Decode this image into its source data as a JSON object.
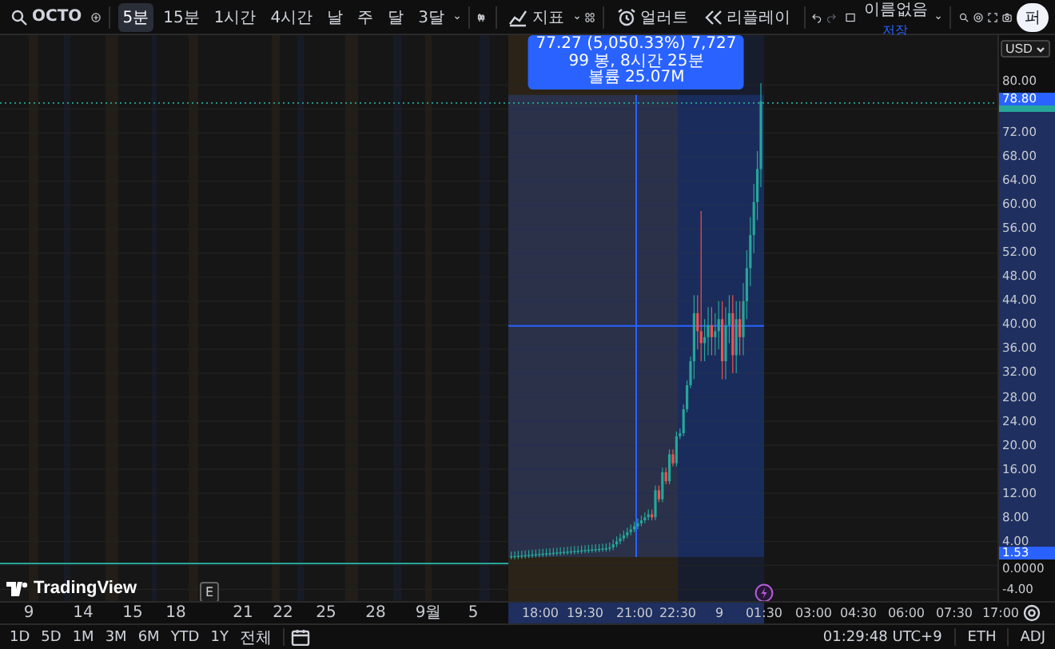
{
  "toolbar": {
    "symbol": "OCTO",
    "intervals": [
      {
        "label": "5분",
        "selected": true
      },
      {
        "label": "15분",
        "selected": false
      },
      {
        "label": "1시간",
        "selected": false
      },
      {
        "label": "4시간",
        "selected": false
      },
      {
        "label": "날",
        "selected": false
      },
      {
        "label": "주",
        "selected": false
      },
      {
        "label": "달",
        "selected": false
      },
      {
        "label": "3달",
        "selected": false
      }
    ],
    "indicators_label": "지표",
    "alert_label": "얼러트",
    "replay_label": "리플레이",
    "layout": {
      "name": "이름없음",
      "status": "저장"
    },
    "profile_button": "퍼"
  },
  "chart": {
    "currency": "USD",
    "price_ticks": [
      "80.00",
      "72.00",
      "68.00",
      "64.00",
      "60.00",
      "56.00",
      "52.00",
      "48.00",
      "44.00",
      "40.00",
      "36.00",
      "32.00",
      "28.00",
      "24.00",
      "20.00",
      "16.00",
      "12.00",
      "8.00",
      "4.00",
      "0.0000",
      "-4.00"
    ],
    "range_high": "78.80",
    "range_low": "1.53",
    "tooltip": [
      "77.27 (5,050.33%) 7,727",
      "99 봉, 8시간 25분",
      "볼륨 25.07M"
    ],
    "event_marker": "E",
    "logo": "TradingView",
    "time_labels": [
      "9",
      "14",
      "15",
      "18",
      "21",
      "22",
      "25",
      "28",
      "9월",
      "5",
      "18:00",
      "19:30",
      "21:00",
      "22:30",
      "9",
      "01:30",
      "03:00",
      "04:30",
      "06:00",
      "07:30",
      "17:00"
    ]
  },
  "bottom_bar": {
    "ranges": [
      "1D",
      "5D",
      "1M",
      "3M",
      "6M",
      "YTD",
      "1Y",
      "전체"
    ],
    "clock": "01:29:48 UTC+9",
    "session": "ETH",
    "adjust": "ADJ"
  }
}
